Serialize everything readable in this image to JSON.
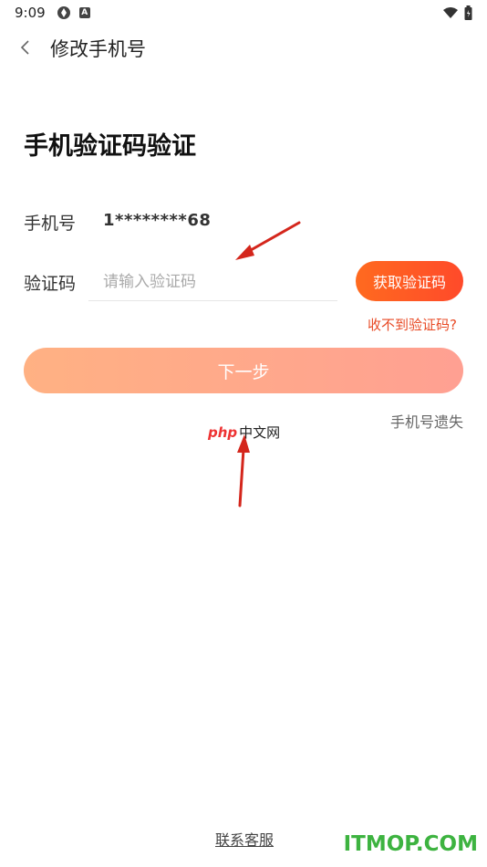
{
  "status_bar": {
    "time": "9:09",
    "icons": [
      "sync-icon",
      "a-badge-icon",
      "wifi-icon",
      "battery-icon"
    ]
  },
  "header": {
    "title": "修改手机号"
  },
  "main": {
    "section_title": "手机验证码验证",
    "phone_label": "手机号",
    "phone_value": "1********68",
    "code_label": "验证码",
    "code_placeholder": "请输入验证码",
    "code_value": "",
    "get_code_label": "获取验证码",
    "no_code_label": "收不到验证码?",
    "next_label": "下一步",
    "lost_phone_label": "手机号遗失"
  },
  "watermark": {
    "php": "php",
    "cn": "中文网"
  },
  "footer": {
    "contact_label": "联系客服",
    "site_logo": "ITMOP.COM"
  },
  "colors": {
    "accent_start": "#ff6a1f",
    "accent_end": "#ff4a2a",
    "link_red": "#e84a25",
    "next_start": "#ffb183",
    "next_end": "#ffa092",
    "arrow_red": "#d4261c",
    "site_logo_green": "#3db340"
  }
}
